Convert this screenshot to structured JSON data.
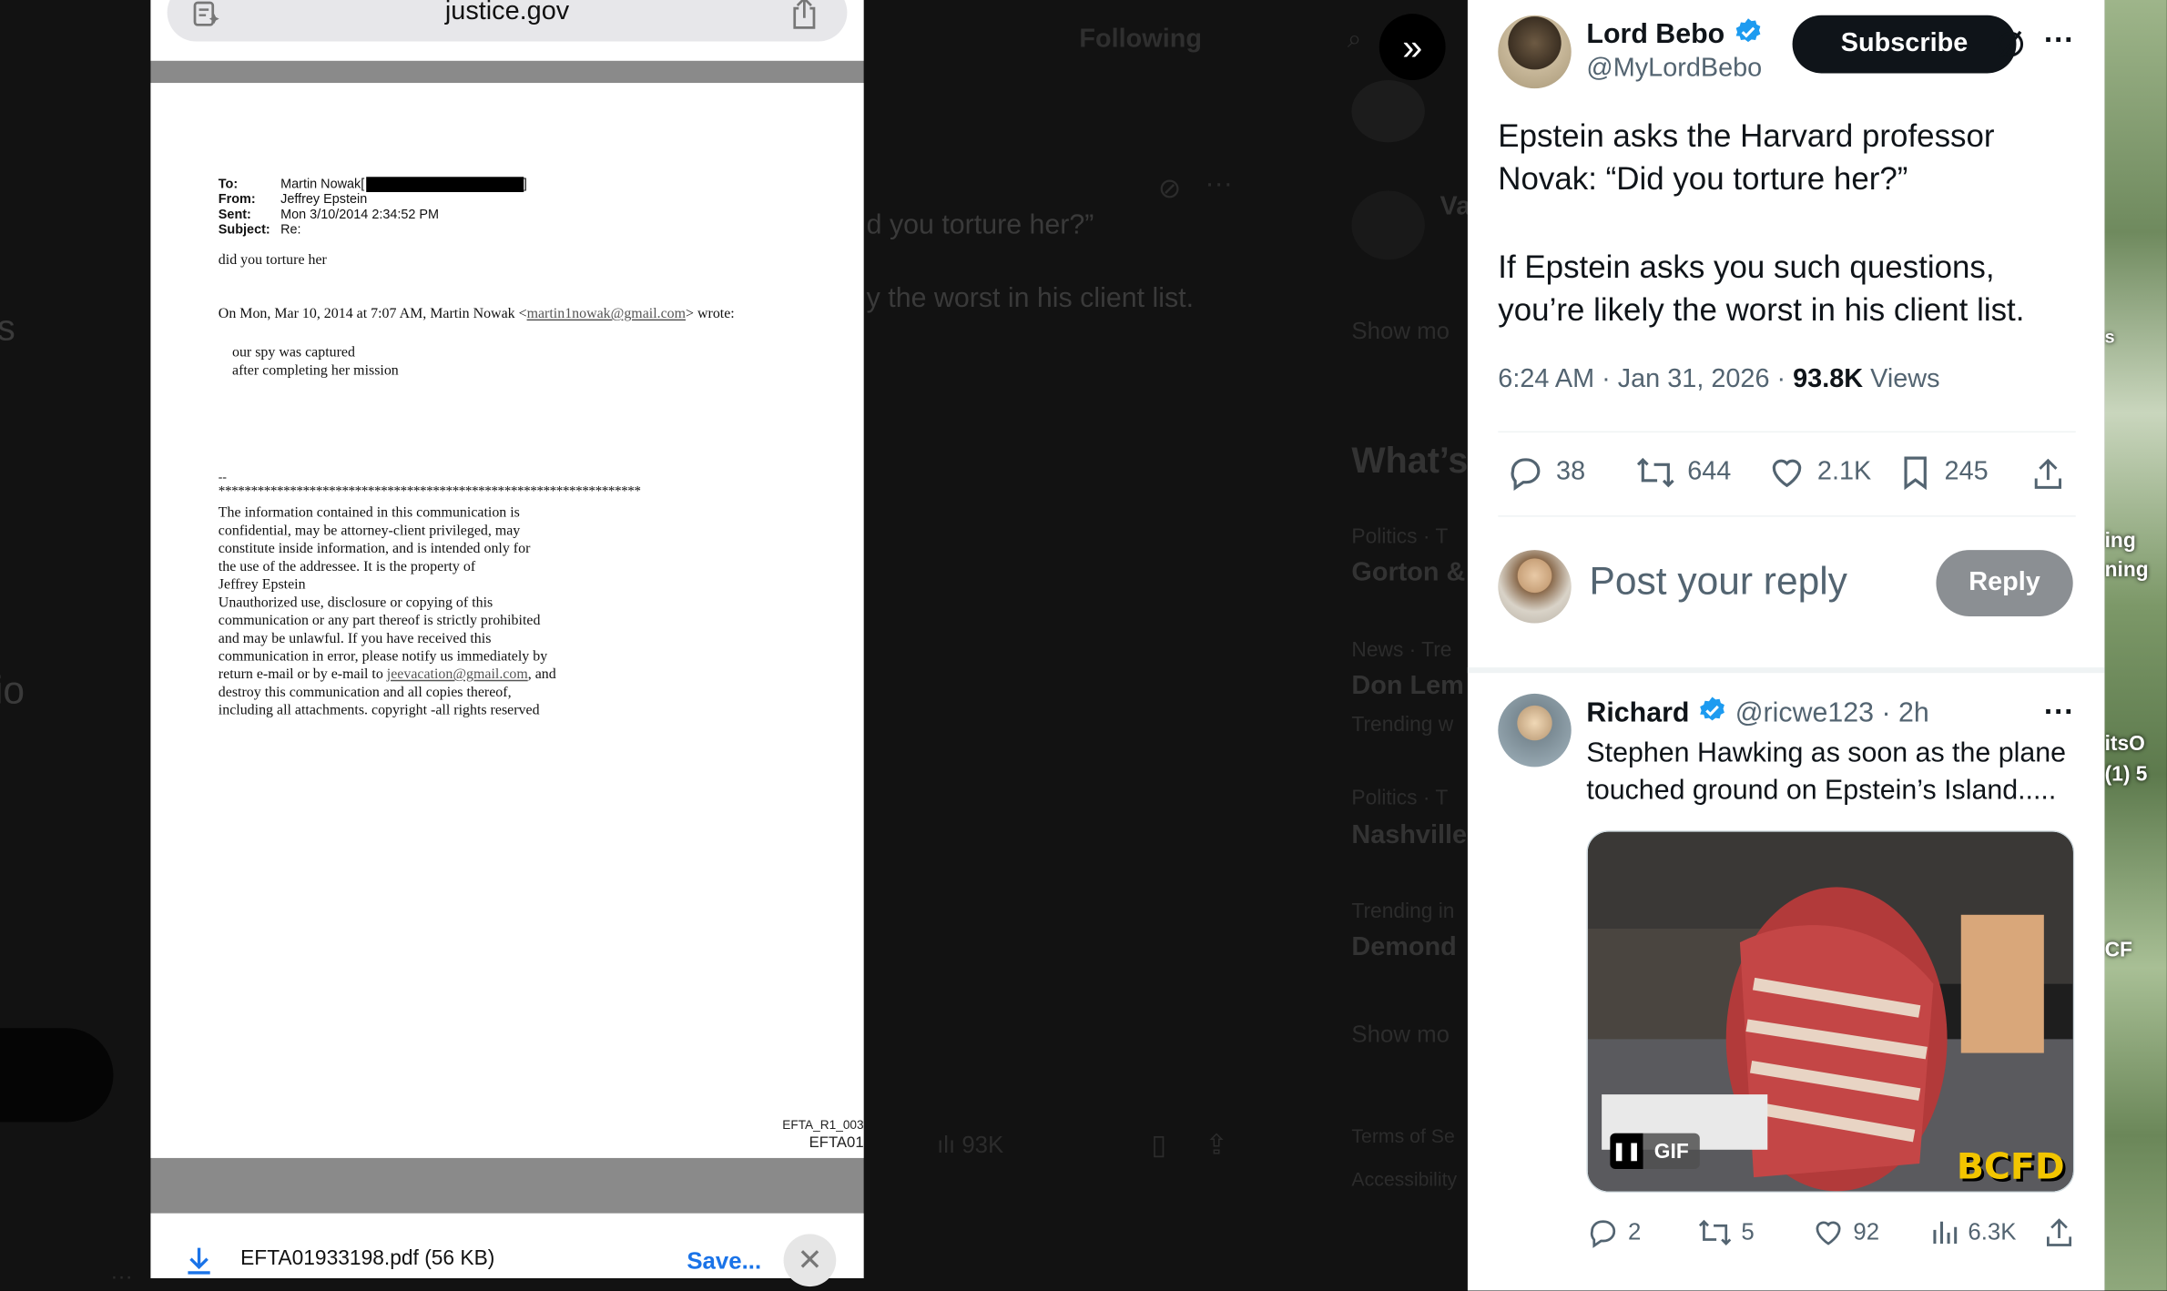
{
  "browser": {
    "url": "justice.gov"
  },
  "document": {
    "headers": [
      {
        "key": "To:",
        "value": "Martin Nowak["
      },
      {
        "key": "From:",
        "value": "Jeffrey Epstein"
      },
      {
        "key": "Sent:",
        "value": "Mon 3/10/2014 2:34:52 PM"
      },
      {
        "key": "Subject:",
        "value": "Re:"
      }
    ],
    "body": "did you torture her",
    "quote_intro_pre": "On Mon, Mar 10, 2014 at 7:07 AM, Martin Nowak <",
    "quote_email": "martin1nowak@gmail.com",
    "quote_intro_post": "> wrote:",
    "quote_lines": [
      "our spy was captured",
      "after completing her mission"
    ],
    "sig_dash": "--",
    "stars": "*****************************************************************",
    "disclaimer_lines": [
      "The information contained in this communication is",
      "confidential, may be attorney-client privileged, may",
      "constitute inside information, and is intended only for",
      "the use of the addressee. It is the property of",
      "Jeffrey Epstein",
      "Unauthorized use, disclosure or copying of this",
      "communication or any part thereof is strictly prohibited",
      "and may be unlawful. If you have received this",
      "communication in error, please notify us immediately by"
    ],
    "disclaimer_link_pre": "return e-mail or by e-mail to ",
    "disclaimer_email": "jeevacation@gmail.com",
    "disclaimer_link_post": ", and",
    "disclaimer_tail": [
      "destroy this communication and all copies thereof,",
      "including all attachments. copyright -all rights reserved"
    ],
    "footer_ref_1": "EFTA_R1_003",
    "footer_ref_2": "EFTA01"
  },
  "download_bar": {
    "filename": "EFTA01933198.pdf (56 KB)",
    "save_label": "Save..."
  },
  "background": {
    "tab_following": "Following",
    "tweet_fragment_1": "d you torture her?”",
    "tweet_fragment_2": "y the worst in his client list.",
    "views_fragment": "93K",
    "whats_fragment": "What’s",
    "show_more_1": "Show mo",
    "show_more_2": "Show mo",
    "trend_rows": [
      {
        "meta": "Politics · T",
        "title": "Gorton &"
      },
      {
        "meta": "News · Tre",
        "title": "Don Lem",
        "sub": "Trending w"
      },
      {
        "meta": "Politics · T",
        "title": "Nashville"
      },
      {
        "meta": "Trending in",
        "title": "Demond"
      }
    ],
    "footer_1": "Terms of Se",
    "footer_2": "Accessibility",
    "left_fragment_1": "s",
    "left_fragment_2": "io",
    "who_1": "Va"
  },
  "tweet": {
    "author_name": "Lord Bebo",
    "author_handle": "@MyLordBebo",
    "subscribe_label": "Subscribe",
    "text_line_1": "Epstein asks the Harvard professor",
    "text_line_2": "Novak: “Did you torture her?”",
    "text_line_3": "If Epstein asks you such questions,",
    "text_line_4": "you’re likely the worst in his client list.",
    "time": "6:24 AM · Jan 31, 2026 · ",
    "views_count": "93.8K",
    "views_label": " Views",
    "replies": "38",
    "reposts": "644",
    "likes": "2.1K",
    "bookmarks": "245",
    "reply_placeholder": "Post your reply",
    "reply_button": "Reply"
  },
  "reply": {
    "name": "Richard",
    "handle_time": "@ricwe123 · 2h",
    "text_line_1": "Stephen Hawking as soon as the plane",
    "text_line_2": "touched ground on Epstein’s Island.....",
    "gif_badge": "GIF",
    "gif_watermark": "BCFD",
    "replies": "2",
    "reposts": "5",
    "likes": "92",
    "views": "6.3K"
  },
  "side_fragments": [
    "s",
    "ing",
    "ning",
    "itsO",
    "(1) 5",
    "CF"
  ],
  "colors": {
    "verified_blue": "#1d9bf0",
    "link_blue": "#1a73e8",
    "text_primary": "#0f1419",
    "text_secondary": "#536471"
  }
}
